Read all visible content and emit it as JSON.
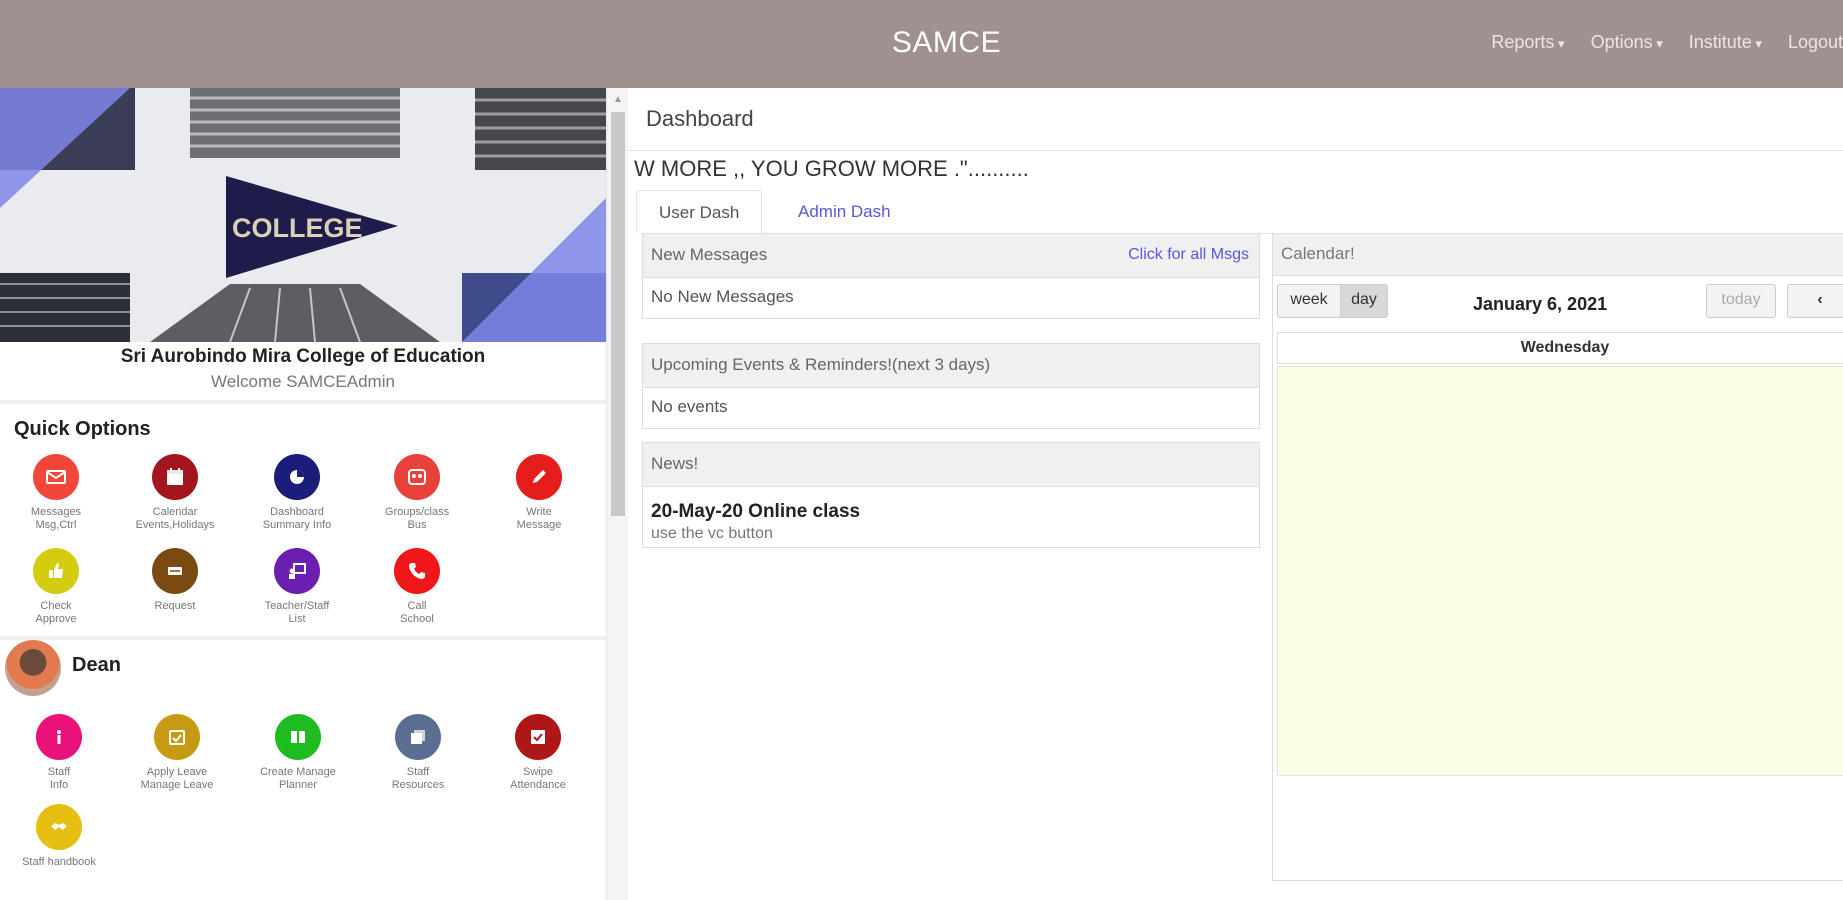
{
  "app": {
    "title": "SAMCE",
    "nav": [
      {
        "label": "Reports"
      },
      {
        "label": "Options"
      },
      {
        "label": "Institute"
      },
      {
        "label": "Logout"
      }
    ]
  },
  "sidebar": {
    "banner_text": "COLLEGE",
    "college_name": "Sri Aurobindo Mira College of Education",
    "welcome": "Welcome SAMCEAdmin",
    "quick_options_title": "Quick Options",
    "quick_options": [
      {
        "line1": "Messages",
        "line2": "Msg,Ctrl",
        "icon": "envelope-icon",
        "color": "#f0473a"
      },
      {
        "line1": "Calendar",
        "line2": "Events,Holidays",
        "icon": "calendar-icon",
        "color": "#a3161e"
      },
      {
        "line1": "Dashboard",
        "line2": "Summary Info",
        "icon": "pie-chart-icon",
        "color": "#1c1c7a"
      },
      {
        "line1": "Groups/class",
        "line2": "Bus",
        "icon": "group-icon",
        "color": "#e8403a"
      },
      {
        "line1": "Write",
        "line2": "Message",
        "icon": "pencil-icon",
        "color": "#e51d1d"
      },
      {
        "line1": "Check",
        "line2": "Approve",
        "icon": "thumbs-up-icon",
        "color": "#d4cc0f"
      },
      {
        "line1": "Request",
        "line2": "",
        "icon": "ticket-icon",
        "color": "#7a4a12"
      },
      {
        "line1": "Teacher/Staff",
        "line2": "List",
        "icon": "teacher-icon",
        "color": "#6a1fb0"
      },
      {
        "line1": "Call",
        "line2": "School",
        "icon": "phone-icon",
        "color": "#ef1717"
      }
    ],
    "dean_label": "Dean",
    "dean_options": [
      {
        "line1": "Staff",
        "line2": "Info",
        "icon": "info-icon",
        "color": "#e8127a"
      },
      {
        "line1": "Apply Leave",
        "line2": "Manage Leave",
        "icon": "calendar-check-icon",
        "color": "#c79a13"
      },
      {
        "line1": "Create Manage",
        "line2": "Planner",
        "icon": "planner-icon",
        "color": "#1ebc1e"
      },
      {
        "line1": "Staff",
        "line2": "Resources",
        "icon": "resources-icon",
        "color": "#5b6e92"
      },
      {
        "line1": "Swipe",
        "line2": "Attendance",
        "icon": "checkbox-icon",
        "color": "#ad1717"
      },
      {
        "line1": "Staff handbook",
        "line2": "",
        "icon": "handshake-icon",
        "color": "#e5c012"
      }
    ]
  },
  "main": {
    "title": "Dashboard",
    "marquee": "W MORE ,, YOU GROW MORE .\"..........",
    "tabs": [
      {
        "label": "User Dash"
      },
      {
        "label": "Admin Dash"
      }
    ],
    "messages": {
      "header": "New Messages",
      "link": "Click for all Msgs",
      "body": "No New Messages"
    },
    "events": {
      "header": "Upcoming Events & Reminders!(next 3 days)",
      "body": "No events"
    },
    "news": {
      "header": "News!",
      "item_title": "20-May-20 Online class",
      "item_body": "use the vc button"
    },
    "calendar": {
      "header": "Calendar!",
      "week_label": "week",
      "day_label": "day",
      "date": "January 6, 2021",
      "today_label": "today",
      "prev_label": "‹",
      "weekday": "Wednesday"
    }
  }
}
